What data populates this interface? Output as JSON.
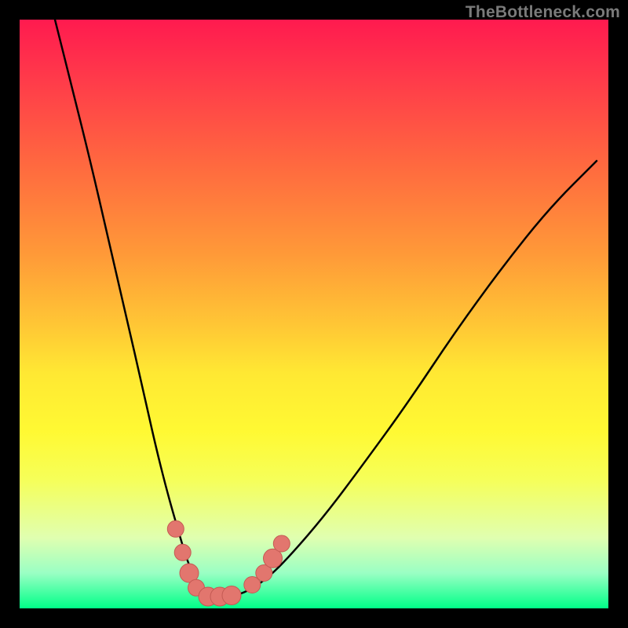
{
  "watermark": "TheBottleneck.com",
  "colors": {
    "curve_stroke": "#000000",
    "dot_fill": "#e2766e",
    "dot_stroke": "#c45a53",
    "background_black": "#000000"
  },
  "chart_data": {
    "type": "line",
    "title": "",
    "xlabel": "",
    "ylabel": "",
    "xlim": [
      0,
      100
    ],
    "ylim": [
      0,
      100
    ],
    "grid": false,
    "legend": false,
    "series": [
      {
        "name": "bottleneck-curve",
        "x": [
          6,
          9,
          12,
          15,
          18,
          21,
          23,
          25,
          27,
          28.5,
          30,
          31.5,
          33,
          35,
          38,
          42,
          46,
          52,
          58,
          66,
          74,
          82,
          90,
          98
        ],
        "y": [
          100,
          88,
          76,
          63,
          50,
          37,
          28,
          20,
          13,
          8,
          4.5,
          2.5,
          2,
          2,
          2.5,
          5,
          9,
          16,
          24,
          35,
          47,
          58,
          68,
          76
        ]
      }
    ],
    "markers": [
      {
        "x": 26.5,
        "y": 13.5,
        "r": 1.4
      },
      {
        "x": 27.7,
        "y": 9.5,
        "r": 1.4
      },
      {
        "x": 28.8,
        "y": 6.0,
        "r": 1.6
      },
      {
        "x": 30.0,
        "y": 3.5,
        "r": 1.4
      },
      {
        "x": 32.0,
        "y": 2.0,
        "r": 1.6
      },
      {
        "x": 34.0,
        "y": 2.0,
        "r": 1.6
      },
      {
        "x": 36.0,
        "y": 2.2,
        "r": 1.6
      },
      {
        "x": 39.5,
        "y": 4.0,
        "r": 1.4
      },
      {
        "x": 41.5,
        "y": 6.0,
        "r": 1.4
      },
      {
        "x": 43.0,
        "y": 8.5,
        "r": 1.6
      },
      {
        "x": 44.5,
        "y": 11.0,
        "r": 1.4
      }
    ]
  }
}
